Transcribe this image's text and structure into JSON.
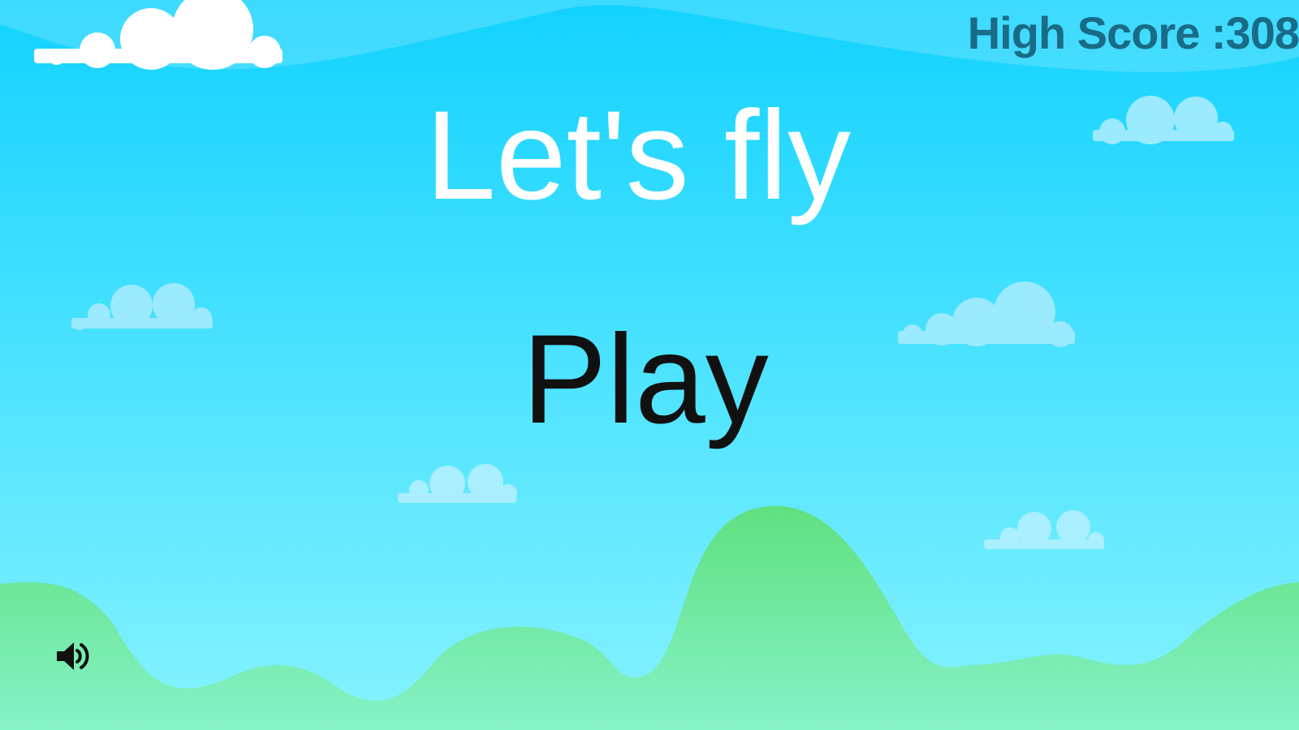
{
  "hud": {
    "high_score_label": "High Score :308"
  },
  "menu": {
    "title": "Let's fly",
    "play_label": "Play"
  },
  "controls": {
    "sound_icon": "speaker-volume-icon"
  },
  "colors": {
    "sky_top": "#12d2ff",
    "sky_bottom": "#86f3ff",
    "cloud_white": "#ffffff",
    "cloud_light": "#9ceaff",
    "hills_top": "#5fe07f",
    "hills_bottom": "#86f2c8",
    "title_text": "#ffffff",
    "play_text": "#111111",
    "high_score_text": "#1a6b86",
    "icon": "#111111"
  }
}
